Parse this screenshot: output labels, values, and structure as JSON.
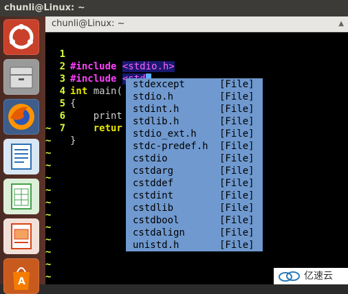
{
  "top_bar": {
    "title": "chunli@Linux: ~"
  },
  "launcher": {
    "items": [
      {
        "icon": "ubuntu-dash-icon",
        "color": "#dd4814"
      },
      {
        "icon": "files-icon",
        "color": "#8e8e8e"
      },
      {
        "icon": "firefox-icon",
        "color": "#e66000"
      },
      {
        "icon": "libreoffice-writer-icon",
        "color": "#2a6fb5"
      },
      {
        "icon": "libreoffice-calc-icon",
        "color": "#43a047"
      },
      {
        "icon": "libreoffice-impress-icon",
        "color": "#d84315"
      },
      {
        "icon": "software-center-icon",
        "color": "#f57c00"
      }
    ]
  },
  "terminal": {
    "title": "chunli@Linux: ~",
    "lines": [
      {
        "num": "1",
        "pp": "#include",
        "str": "<stdio.h>"
      },
      {
        "num": "2",
        "pp": "#include",
        "str": "<std"
      },
      {
        "num": "3",
        "kw": "int",
        "plain": " main("
      },
      {
        "num": "4",
        "plain": "{"
      },
      {
        "num": "5",
        "plain": "    print"
      },
      {
        "num": "6",
        "kw": "    retur"
      },
      {
        "num": "7",
        "plain": "}"
      }
    ],
    "tilde": "~"
  },
  "completion": {
    "items": [
      {
        "name": "stdexcept",
        "kind": "[File]"
      },
      {
        "name": "stdio.h",
        "kind": "[File]"
      },
      {
        "name": "stdint.h",
        "kind": "[File]"
      },
      {
        "name": "stdlib.h",
        "kind": "[File]"
      },
      {
        "name": "stdio_ext.h",
        "kind": "[File]"
      },
      {
        "name": "stdc-predef.h",
        "kind": "[File]"
      },
      {
        "name": "cstdio",
        "kind": "[File]"
      },
      {
        "name": "cstdarg",
        "kind": "[File]"
      },
      {
        "name": "cstddef",
        "kind": "[File]"
      },
      {
        "name": "cstdint",
        "kind": "[File]"
      },
      {
        "name": "cstdlib",
        "kind": "[File]"
      },
      {
        "name": "cstdbool",
        "kind": "[File]"
      },
      {
        "name": "cstdalign",
        "kind": "[File]"
      },
      {
        "name": "unistd.h",
        "kind": "[File]"
      }
    ]
  },
  "watermark": {
    "text": "亿速云"
  }
}
